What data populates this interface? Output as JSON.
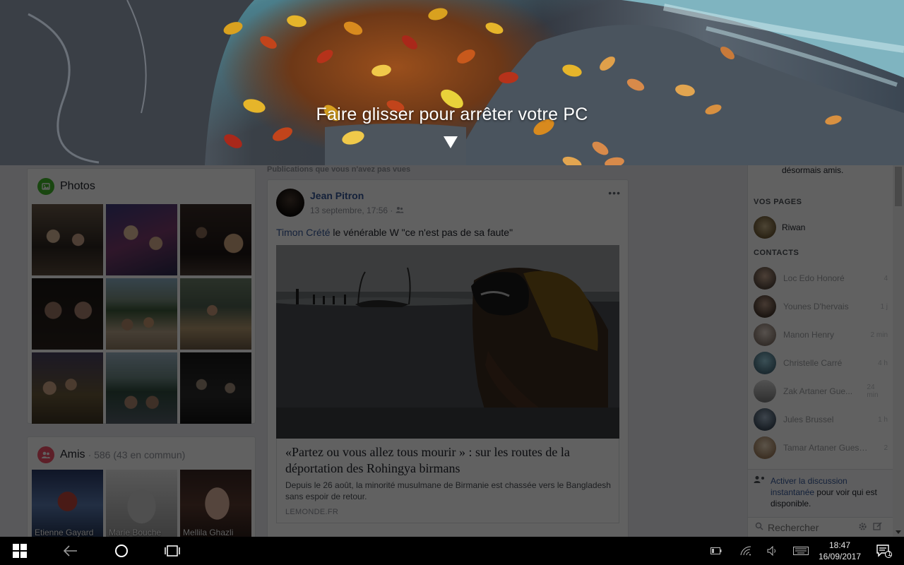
{
  "slide_to_shutdown": {
    "message": "Faire glisser pour arrêter votre PC"
  },
  "photos": {
    "title": "Photos",
    "icon": "photo-icon",
    "accent": "#42b72a"
  },
  "friends": {
    "title": "Amis",
    "count": "· 586 (43 en commun)",
    "icon": "friends-icon",
    "accent": "#f35369",
    "items": [
      {
        "name": "Etienne Gayard"
      },
      {
        "name": "Marie Bouche"
      },
      {
        "name": "Mellila Ghazli"
      }
    ]
  },
  "feed": {
    "unseen_label": "Publications que vous n'avez pas vues",
    "post": {
      "author": "Jean Pitron",
      "timestamp": "13 septembre, 17:56 ·",
      "text_tag": "Timon Crété",
      "text": " le vénérable W \"ce n'est pas de sa faute\"",
      "link": {
        "title": "«Partez ou vous allez tous mourir » : sur les routes de la déportation des Rohingya birmans",
        "description": "Depuis le 26 août, la minorité musulmane de Birmanie est chassée vers le Bangladesh sans espoir de retour.",
        "domain": "LEMONDE.FR"
      }
    }
  },
  "sidebar": {
    "notification_fragment": "désormais amis.",
    "pages_header": "VOS PAGES",
    "page_name": "Riwan",
    "contacts_header": "CONTACTS",
    "contacts": [
      {
        "name": "Loc Edo Honoré",
        "time": "4"
      },
      {
        "name": "Younes D'hervais",
        "time": "1 j"
      },
      {
        "name": "Manon Henry",
        "time": "2 min"
      },
      {
        "name": "Christelle Carré",
        "time": "4 h"
      },
      {
        "name": "Zak Artaner Gue...",
        "time": "24 min"
      },
      {
        "name": "Jules Brussel",
        "time": "1 h"
      },
      {
        "name": "Tamar Artaner Guess...",
        "time": "2"
      }
    ],
    "chat": {
      "link1": "Activer la discussion",
      "link2": "instantanée",
      "rest": " pour voir qui est disponible."
    },
    "search_placeholder": "Rechercher"
  },
  "taskbar": {
    "time": "18:47",
    "date": "16/09/2017",
    "notification_count": "1"
  }
}
